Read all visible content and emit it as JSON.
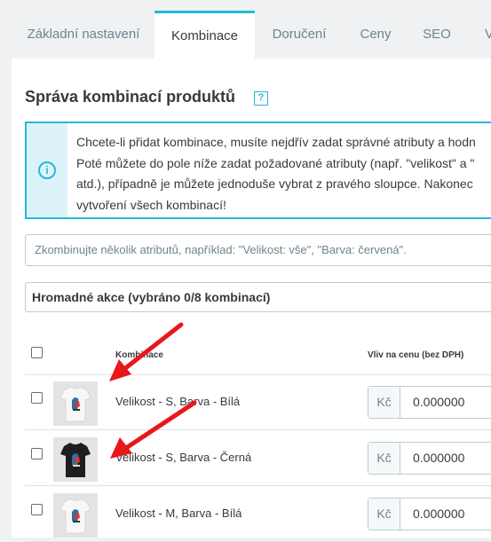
{
  "tabs": [
    {
      "label": "Základní nastavení",
      "active": false
    },
    {
      "label": "Kombinace",
      "active": true
    },
    {
      "label": "Doručení",
      "active": false
    },
    {
      "label": "Ceny",
      "active": false
    },
    {
      "label": "SEO",
      "active": false
    },
    {
      "label": "V",
      "active": false
    }
  ],
  "section": {
    "title": "Správa kombinací produktů",
    "help_label": "?"
  },
  "alert": {
    "icon_glyph": "i",
    "lines": [
      "Chcete-li přidat kombinace, musíte nejdřív zadat správné atributy a hodn",
      "Poté můžete do pole níže zadat požadované atributy (např. \"velikost\" a \"",
      "atd.), případně je můžete jednoduše vybrat z pravého sloupce. Nakonec",
      "vytvoření všech kombinací!"
    ]
  },
  "attribute_input": {
    "placeholder": "Zkombinujte několik atributů, například: \"Velikost: vše\", \"Barva: červená\"."
  },
  "bulk_actions": {
    "label": "Hromadné akce (vybráno 0/8 kombinací)"
  },
  "table": {
    "headers": {
      "combination": "Kombinace",
      "price_impact": "Vliv na cenu (bez DPH)",
      "next_col_top": "K",
      "next_col_bottom": "(b"
    },
    "rows": [
      {
        "label": "Velikost - S, Barva - Bílá",
        "currency": "Kč",
        "price": "0.000000",
        "shirt_color": "white"
      },
      {
        "label": "Velikost - S, Barva - Černá",
        "currency": "Kč",
        "price": "0.000000",
        "shirt_color": "black"
      },
      {
        "label": "Velikost - M, Barva - Bílá",
        "currency": "Kč",
        "price": "0.000000",
        "shirt_color": "white"
      }
    ]
  },
  "colors": {
    "accent": "#25b9d7",
    "arrow": "#e8171c",
    "text": "#363a41",
    "muted": "#6c868e"
  }
}
